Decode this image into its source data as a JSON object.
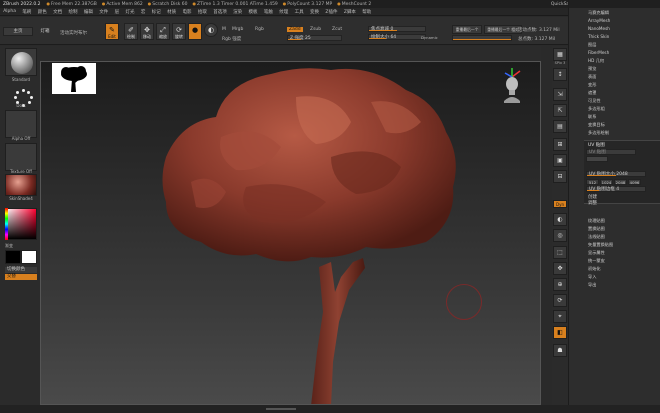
{
  "titlebar": {
    "app": "ZBrush 2022.0.2",
    "items": [
      "Free Mem 22.387GB",
      "Active Mem 862",
      "Scratch Disk 60",
      "ZTime 1.3 Timer 0.001 ATime 1.459",
      "PolyCount 3.127 MP",
      "MeshCount 2"
    ],
    "quicksave": "QuickSave",
    "seethrough": "透明度 0",
    "menus": "菜单",
    "script": "DefaultZScript"
  },
  "menubar": {
    "items": [
      "Alpha",
      "笔刷",
      "颜色",
      "文档",
      "绘制",
      "编辑",
      "文件",
      "层",
      "灯光",
      "宏",
      "标记",
      "材质",
      "电影",
      "拾取",
      "首选项",
      "渲染",
      "模板",
      "笔触",
      "纹理",
      "工具",
      "变换",
      "Z插件",
      "Z脚本",
      "帮助"
    ]
  },
  "toolbar": {
    "home": "主页",
    "lightbox": "灯箱",
    "live_boolean": "活动实时布尔",
    "edit": "Edit",
    "draw": "绘制",
    "move": "移动",
    "scale": "缩放",
    "rotate": "旋转",
    "mrgb": "Mrgb",
    "rgb": "Rgb",
    "m": "M",
    "zadd": "Zadd",
    "zsub": "Zsub",
    "zcut": "Zcut",
    "rgb_intensity": "Rgb 强度",
    "z_intensity_label": "Z 强度",
    "z_intensity_value": "25",
    "focal_shift_label": "焦点衰减",
    "focal_shift_value": "0",
    "draw_size_label": "绘制大小",
    "draw_size_value": "64",
    "dynamic": "Dynamic",
    "active_points": "活动点数: 3.127 Mil",
    "total_points": "总点数: 3.127 Mil",
    "replay_last": "重播最后一个",
    "replay_last_rel": "重播最后一个 相对"
  },
  "leftpanel": {
    "brush_label": "Standard",
    "stroke_label": "Dots",
    "alpha_label": "Alpha Off",
    "texture_label": "Texture Off",
    "material_label": "SkinShade4",
    "gradient_label": "渐变",
    "switch_color": "切换颜色",
    "alternate": "交替"
  },
  "rightstrip": {
    "buttons": [
      {
        "label": "SPix 3",
        "glyph": "▦"
      },
      {
        "label": "",
        "glyph": "↕"
      },
      {
        "label": "",
        "glyph": "⇲"
      },
      {
        "label": "",
        "glyph": "⇱"
      },
      {
        "label": "",
        "glyph": "▤"
      },
      {
        "label": "",
        "glyph": "⊞"
      },
      {
        "label": "",
        "glyph": "▣"
      },
      {
        "label": "",
        "glyph": "⊟"
      },
      {
        "label": "Dyn",
        "glyph": ""
      },
      {
        "label": "",
        "glyph": "◐"
      },
      {
        "label": "",
        "glyph": "◎"
      },
      {
        "label": "",
        "glyph": "⬚"
      },
      {
        "label": "",
        "glyph": "✥"
      },
      {
        "label": "",
        "glyph": "⊕"
      },
      {
        "label": "",
        "glyph": "⟳"
      },
      {
        "label": "",
        "glyph": "⌖"
      },
      {
        "label": "",
        "glyph": "◧"
      },
      {
        "label": "",
        "glyph": "☗"
      }
    ]
  },
  "rightpanel": {
    "items_top": [
      "马赛克编辑",
      "ArrayMesh",
      "NanoMesh",
      "Thick Skin",
      "图层",
      "FiberMesh",
      "HD 几何",
      "预览",
      "表面",
      "变形",
      "遮罩",
      "可见性",
      "多边形组",
      "联系",
      "变换目标",
      "多边形绘制"
    ],
    "uv_title": "UV 贴图",
    "uv_slider1": "UV 贴图",
    "uv_slider2": "UV 贴图大小 2048",
    "uv_sizes": [
      "512",
      "1024",
      "2048",
      "4096"
    ],
    "uv_border": "UV 贴图边框 4",
    "uv_text1": "创建",
    "uv_text2": "调整",
    "items_bottom": [
      "纹理贴图",
      "置换贴图",
      "法线贴图",
      "矢量置换贴图",
      "显示属性",
      "统一蒙皮",
      "初始化",
      "导入",
      "导出"
    ]
  },
  "colors": {
    "accent": "#d8801e",
    "tree_canopy": "#8a3a2c",
    "tree_canopy_light": "#b65a45",
    "tree_trunk": "#7a3326"
  }
}
